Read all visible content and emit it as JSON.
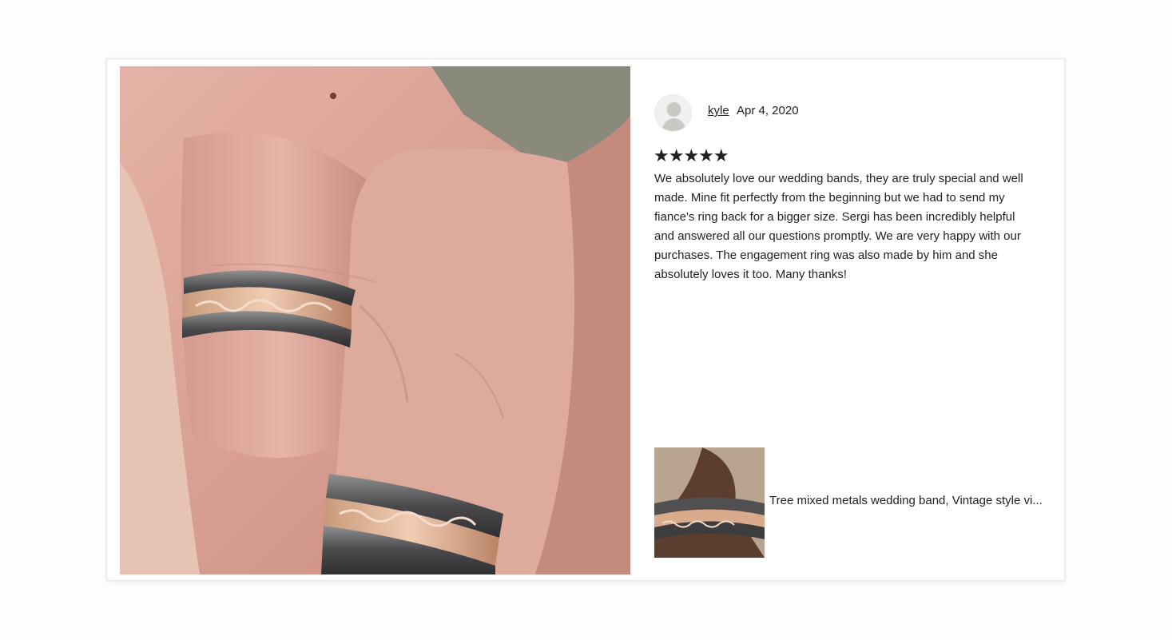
{
  "review": {
    "username": "kyle",
    "date": "Apr 4, 2020",
    "rating": 5,
    "stars": "★★★★★",
    "text": "We absolutely love our wedding bands, they are truly special and well made. Mine fit perfectly from the beginning but we had to send my fiance's ring back for a bigger size. Sergi has been incredibly helpful and answered all our questions promptly. We are very happy with our purchases. The engagement ring was also made by him and she absolutely loves it too. Many thanks!"
  },
  "product": {
    "title": "Tree mixed metals wedding band, Vintage style vi..."
  },
  "icons": {
    "avatar": "default-avatar-icon",
    "star": "star-icon"
  },
  "colors": {
    "text": "#222222",
    "card_border": "#e6e6e6",
    "page_background": "#fdfdfd"
  }
}
